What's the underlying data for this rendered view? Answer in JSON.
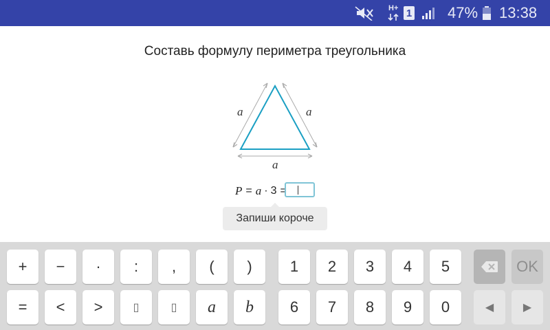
{
  "status_bar": {
    "network": "H+",
    "sim": "1",
    "battery": "47%",
    "time": "13:38"
  },
  "task": {
    "title": "Составь формулу периметра треугольника",
    "side_labels": [
      "a",
      "a",
      "a"
    ],
    "formula": {
      "lhs": "P",
      "eq1": "=",
      "var": "a",
      "op": "·",
      "num": "3",
      "eq2": "="
    },
    "answer_value": "",
    "hint": "Запиши короче"
  },
  "keyboard": {
    "row1": [
      "+",
      "−",
      "·",
      ":",
      ",",
      "(",
      ")",
      "1",
      "2",
      "3",
      "4",
      "5"
    ],
    "row2": [
      "=",
      "<",
      ">",
      "▯",
      "▯",
      "a",
      "b",
      "6",
      "7",
      "8",
      "9",
      "0"
    ],
    "ok_label": "OK",
    "left_arrow": "◀",
    "right_arrow": "▶"
  },
  "colors": {
    "status_bar": "#3443a8",
    "triangle": "#1a9fc3",
    "answer_border": "#7fc4d6",
    "keyboard_bg": "#d9d9d9"
  }
}
